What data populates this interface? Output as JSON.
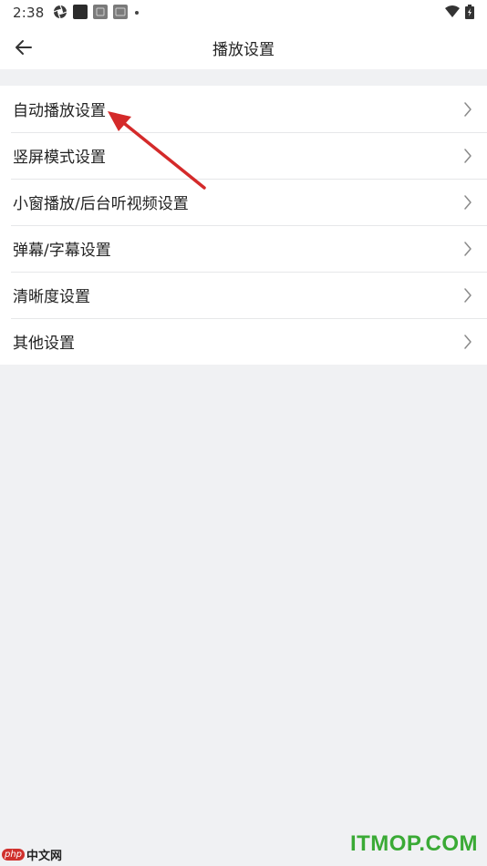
{
  "status_bar": {
    "time": "2:38",
    "left_icons": [
      "aperture-icon",
      "app-icon-dark",
      "app-icon-gray",
      "app-icon-gray",
      "dot-icon"
    ],
    "right_icons": [
      "wifi-icon",
      "battery-charging-icon"
    ]
  },
  "header": {
    "title": "播放设置",
    "back_icon": "arrow-left-icon"
  },
  "settings": {
    "items": [
      {
        "label": "自动播放设置"
      },
      {
        "label": "竖屏模式设置"
      },
      {
        "label": "小窗播放/后台听视频设置"
      },
      {
        "label": "弹幕/字幕设置"
      },
      {
        "label": "清晰度设置"
      },
      {
        "label": "其他设置"
      }
    ]
  },
  "annotation": {
    "color": "#d42a2a",
    "icon": "red-arrow-annotation"
  },
  "watermark": {
    "left_logo": "php",
    "left_text": "中文网",
    "right_text": "ITMOP.COM"
  },
  "colors": {
    "background": "#f0f1f3",
    "surface": "#ffffff",
    "text": "#222222",
    "chevron": "#8a8a8a",
    "watermark_green": "#3aaa35"
  }
}
